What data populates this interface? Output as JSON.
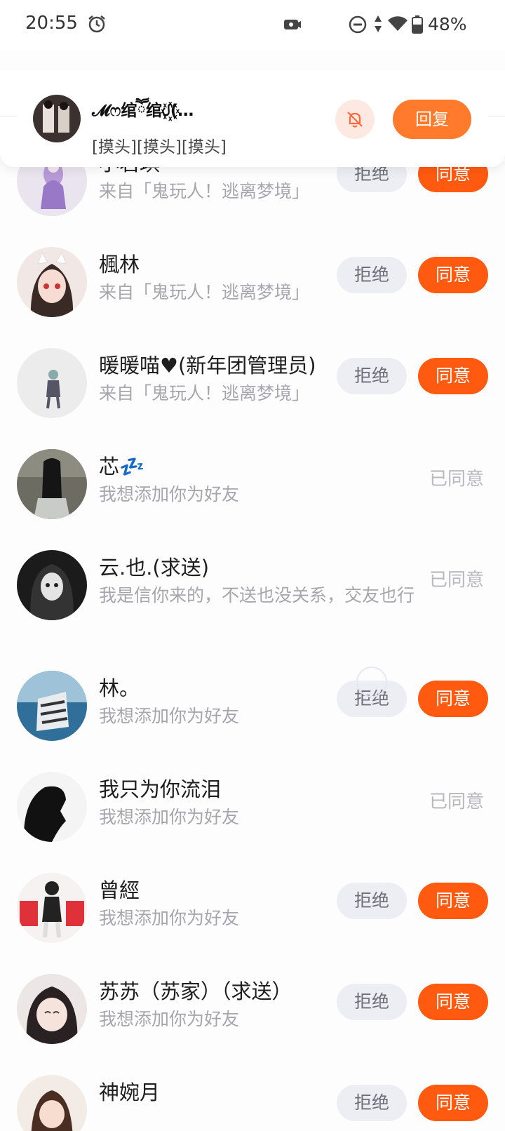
{
  "status_bar": {
    "time": "20:55",
    "battery": "48%"
  },
  "notification": {
    "name": "𝓜ෆ绾ཽ绾ᦔ꙰(…",
    "message": "[摸头][摸头][摸头]",
    "reply_label": "回复"
  },
  "requests": [
    {
      "name": "小君琪",
      "subtitle": "来自「鬼玩人！逃离梦境」",
      "status": "pending"
    },
    {
      "name": "楓林",
      "subtitle": "来自「鬼玩人！逃离梦境」",
      "status": "pending"
    },
    {
      "name": "暖暖喵♥(新年团管理员)",
      "subtitle": "来自「鬼玩人！逃离梦境」",
      "status": "pending"
    },
    {
      "name": "芯💤",
      "subtitle": "我想添加你为好友",
      "status": "accepted"
    },
    {
      "name": "云.也.(求送)",
      "subtitle": "我是信你来的，不送也没关系，交友也行",
      "status": "accepted"
    },
    {
      "name": "林。",
      "subtitle": "我想添加你为好友",
      "status": "pending"
    },
    {
      "name": "我只为你流泪",
      "subtitle": "我想添加你为好友",
      "status": "accepted"
    },
    {
      "name": "曾經",
      "subtitle": "我想添加你为好友",
      "status": "pending"
    },
    {
      "name": "苏苏（苏家）（求送）",
      "subtitle": "我想添加你为好友",
      "status": "pending"
    },
    {
      "name": "神婉月",
      "subtitle": "",
      "status": "pending"
    }
  ],
  "labels": {
    "reject": "拒绝",
    "accept": "同意",
    "accepted": "已同意"
  },
  "colors": {
    "accent": "#ff5a10",
    "reply": "#ff7a2b",
    "muted_text": "#a6a6ad"
  }
}
